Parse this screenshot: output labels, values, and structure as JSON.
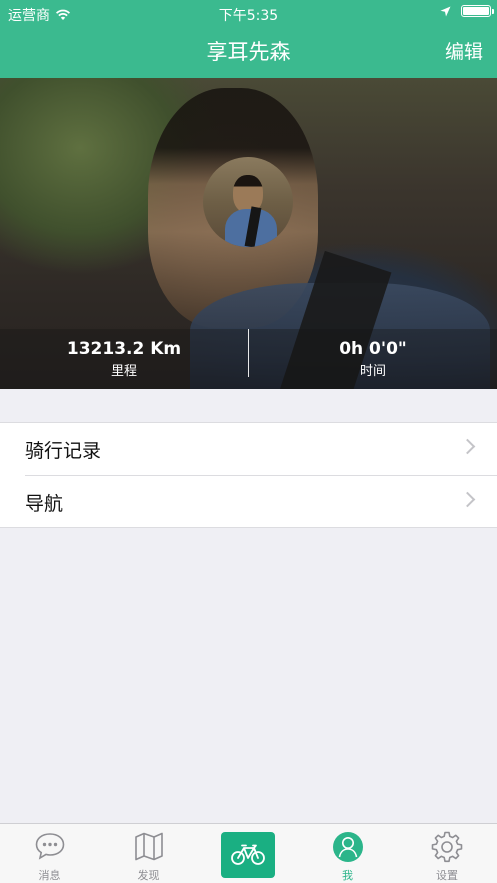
{
  "status_bar": {
    "carrier": "运营商",
    "time": "下午5:35"
  },
  "nav": {
    "title": "享耳先森",
    "edit_label": "编辑"
  },
  "profile": {
    "distance_value": "13213.2 Km",
    "distance_label": "里程",
    "time_value": "0h 0'0\"",
    "time_label": "时间"
  },
  "menu": {
    "items": [
      {
        "label": "骑行记录"
      },
      {
        "label": "导航"
      }
    ]
  },
  "tabbar": {
    "tabs": [
      {
        "label": "消息",
        "icon": "chat-bubble-icon"
      },
      {
        "label": "发现",
        "icon": "map-icon"
      },
      {
        "label": "",
        "icon": "bicycle-icon"
      },
      {
        "label": "我",
        "icon": "person-icon"
      },
      {
        "label": "设置",
        "icon": "gear-icon"
      }
    ],
    "active_index": 3
  },
  "colors": {
    "accent": "#3bba8f",
    "tab_active": "#2bb58a",
    "center_button": "#1aaf82"
  }
}
